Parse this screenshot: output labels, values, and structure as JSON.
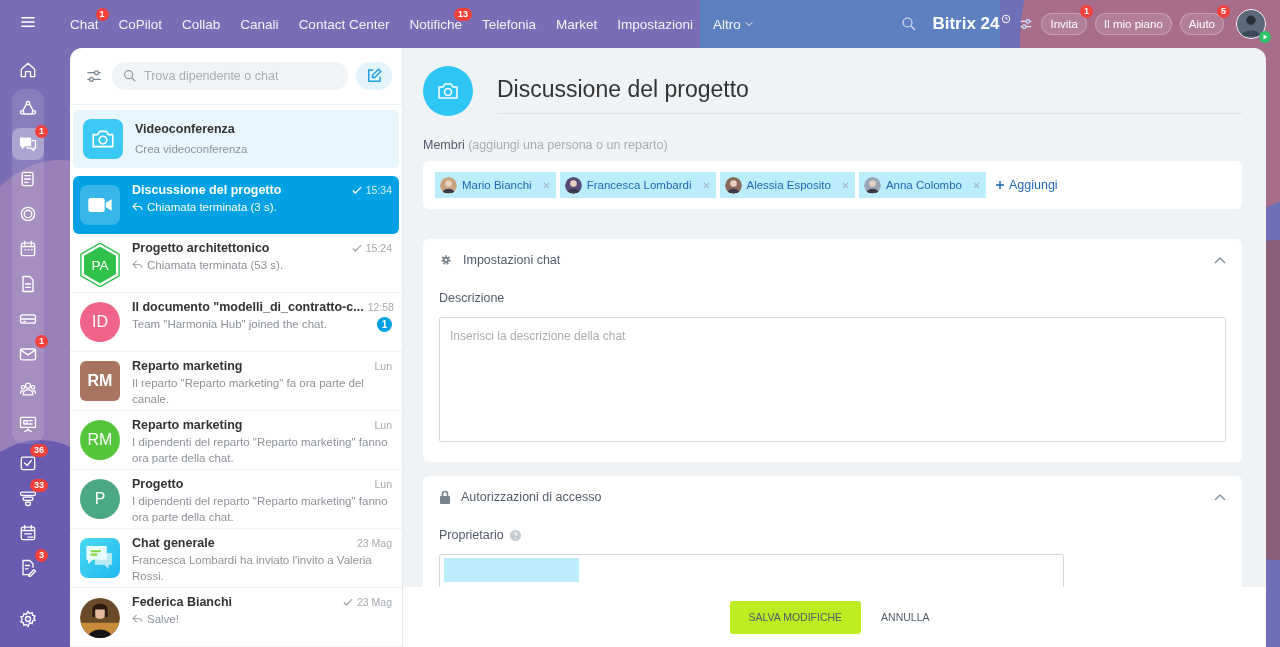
{
  "topnav": {
    "items": [
      {
        "label": "Chat",
        "badge": "1"
      },
      {
        "label": "CoPilot"
      },
      {
        "label": "Collab"
      },
      {
        "label": "Canali"
      },
      {
        "label": "Contact Center"
      },
      {
        "label": "Notifiche",
        "badge": "13"
      },
      {
        "label": "Telefonia"
      },
      {
        "label": "Market"
      },
      {
        "label": "Impostazioni"
      },
      {
        "label": "Altro",
        "dropdown": true
      }
    ],
    "brand": {
      "name": "Bitrix",
      "number": "24"
    },
    "buttons": [
      {
        "label": "Invita",
        "badge": "1"
      },
      {
        "label": "Il mio piano"
      },
      {
        "label": "Aiuto",
        "badge": "5"
      }
    ]
  },
  "rail": {
    "top": [
      {
        "selected": false
      }
    ],
    "grouped": [
      {
        "selected": false
      },
      {
        "selected": true,
        "badge": "1"
      },
      {
        "selected": false
      },
      {
        "selected": false
      },
      {
        "selected": false
      },
      {
        "selected": false
      },
      {
        "selected": false
      },
      {
        "selected": false,
        "badge": "1"
      },
      {
        "selected": false
      },
      {
        "selected": false
      }
    ],
    "bottom": [
      {
        "selected": false,
        "badge": "36"
      },
      {
        "selected": false,
        "badge": "33"
      },
      {
        "selected": false
      },
      {
        "selected": false,
        "badge": "3"
      }
    ]
  },
  "chat_list": {
    "search": {
      "placeholder": "Trova dipendente o chat"
    },
    "videoconference": {
      "title": "Videoconferenza",
      "subtitle": "Crea videoconferenza"
    },
    "chats": [
      {
        "title": "Discussione del progetto",
        "preview": "Chiamata terminata (3 s).",
        "time": "15:34",
        "read": true,
        "reply": true,
        "selected": true,
        "avatar": {
          "kind": "video"
        }
      },
      {
        "title": "Progetto architettonico",
        "preview": "Chiamata terminata (53 s).",
        "time": "15:24",
        "read": true,
        "reply": true,
        "selected": false,
        "avatar": {
          "kind": "hexagon",
          "initials": "PA",
          "color": "#2fc14a"
        }
      },
      {
        "title": "Il documento \"modelli_di_contratto-c...",
        "preview": "Team \"Harmonia Hub\" joined the chat.",
        "time": "12:58",
        "read": false,
        "reply": false,
        "unread": "1",
        "selected": false,
        "avatar": {
          "kind": "circle",
          "initials": "ID",
          "color": "#f0648a"
        }
      },
      {
        "title": "Reparto marketing",
        "preview": "Il reparto \"Reparto marketing\" fa ora parte del canale.",
        "time": "Lun",
        "read": false,
        "reply": false,
        "selected": false,
        "avatar": {
          "kind": "square",
          "initials": "RM",
          "color": "#a8735f"
        }
      },
      {
        "title": "Reparto marketing",
        "preview": "I dipendenti del reparto \"Reparto marketing\" fanno ora parte della chat.",
        "time": "Lun",
        "read": false,
        "reply": false,
        "selected": false,
        "avatar": {
          "kind": "circle",
          "initials": "RM",
          "color": "#55c63c"
        }
      },
      {
        "title": "Progetto",
        "preview": "I dipendenti del reparto \"Reparto marketing\" fanno ora parte della chat.",
        "time": "Lun",
        "read": false,
        "reply": false,
        "selected": false,
        "avatar": {
          "kind": "circle",
          "initials": "P",
          "color": "#4aa883"
        }
      },
      {
        "title": "Chat generale",
        "preview": "Francesca Lombardi ha inviato l'invito a Valeria Rossi.",
        "time": "23 Mag",
        "read": false,
        "reply": false,
        "selected": false,
        "avatar": {
          "kind": "chat"
        }
      },
      {
        "title": "Federica Bianchi",
        "preview": "Salve!",
        "time": "23 Mag",
        "read": true,
        "reply": true,
        "selected": false
      }
    ]
  },
  "settings": {
    "title": "Discussione del progetto",
    "members": {
      "label": "Membri",
      "hint": "(aggiungi una persona o un reparto)",
      "people": [
        {
          "name": "Mario Bianchi"
        },
        {
          "name": "Francesca Lombardi"
        },
        {
          "name": "Alessia Esposito"
        },
        {
          "name": "Anna Colombo"
        }
      ],
      "add": "Aggiungi"
    },
    "sections": [
      {
        "kind": "chat",
        "title": "Impostazioni chat",
        "expanded": true,
        "field_label": "Descrizione",
        "placeholder": "Inserisci la descrizione della chat"
      },
      {
        "kind": "access",
        "title": "Autorizzazioni di accesso",
        "expanded": true,
        "field_label": "Proprietario"
      }
    ],
    "buttons": {
      "save": "SALVA MODIFICHE",
      "cancel": "ANNULLA"
    }
  }
}
